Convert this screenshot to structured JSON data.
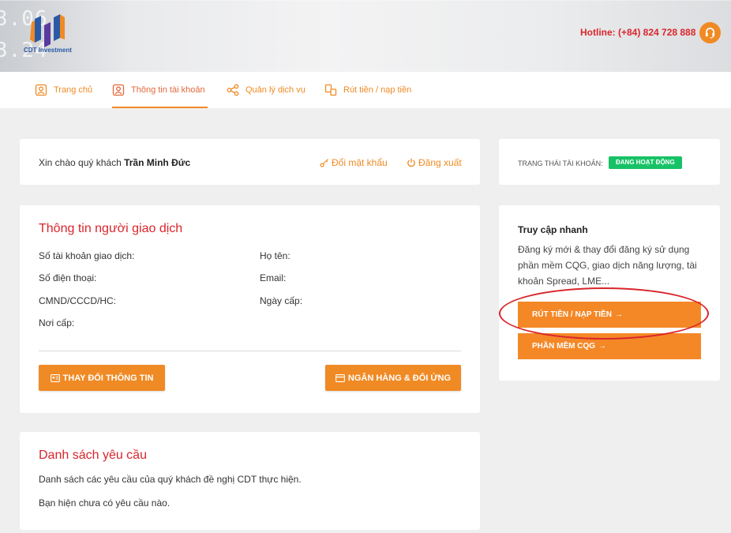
{
  "header": {
    "ticker_line1": "3.06",
    "ticker_line2": "3.24",
    "logo_text": "CDT Investment",
    "hotline": "Hotline: (+84) 824 728 888"
  },
  "nav": {
    "items": [
      {
        "label": "Trang chủ"
      },
      {
        "label": "Thông tin tài khoản"
      },
      {
        "label": "Quản lý dịch vụ"
      },
      {
        "label": "Rút tiền / nạp tiền"
      }
    ]
  },
  "greeting": {
    "prefix": "Xin chào quý khách",
    "name": "Trần Minh Đức",
    "change_password": "Đổi mật khẩu",
    "logout": "Đăng xuất"
  },
  "status": {
    "label": "TRẠNG THÁI TÀI KHOẢN:",
    "badge": "ĐANG HOẠT ĐỘNG",
    "badge_color": "#17c266"
  },
  "trader_info": {
    "title": "Thông tin người giao dịch",
    "account_no": "Số tài khoản giao dịch:",
    "full_name": "Họ tên:",
    "phone": "Số điện thoại:",
    "email": "Email:",
    "id_card": "CMND/CCCD/HC:",
    "issue_date": "Ngày cấp:",
    "issue_place": "Nơi cấp:",
    "change_info_btn": "THAY ĐỔI THÔNG TIN",
    "bank_btn": "NGÂN HÀNG & ĐỐI ỨNG"
  },
  "quick_access": {
    "title": "Truy cập nhanh",
    "desc": "Đăng ký mới & thay đổi đăng ký sử dụng phần mềm CQG, giao dịch năng lượng, tài khoản Spread, LME...",
    "withdraw_btn": "RÚT TIỀN / NẠP TIỀN",
    "cqg_btn": "PHẦN MỀM CQG"
  },
  "requests": {
    "title": "Danh sách yêu cầu",
    "desc": "Danh sách các yêu cầu của quý khách đề nghị CDT thực hiện.",
    "empty": "Bạn hiện chưa có yêu cầu nào."
  },
  "colors": {
    "accent": "#f08a24",
    "title_red": "#d9262c"
  }
}
